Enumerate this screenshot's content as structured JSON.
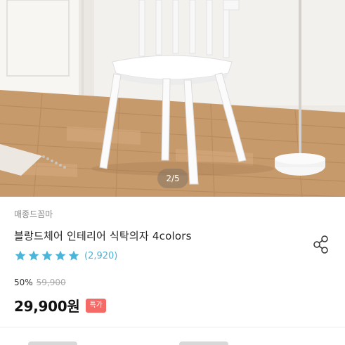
{
  "gallery": {
    "page_indicator": "2/5"
  },
  "product": {
    "brand": "매종드꼼마",
    "title": "블랑드체어 인테리어 식탁의자 4colors",
    "rating": {
      "stars": 5,
      "max_stars": 5,
      "review_count": "(2,920)"
    },
    "discount": "50%",
    "original_price": "59,900",
    "price": "29,900원",
    "badge": "특가"
  },
  "icons": {
    "share": "share-icon",
    "star": "star-icon"
  },
  "colors": {
    "star": "#4ab5d8",
    "review_count": "#4ab5d8",
    "badge_bg": "#f36a66",
    "original_price": "#a8a8a8"
  }
}
